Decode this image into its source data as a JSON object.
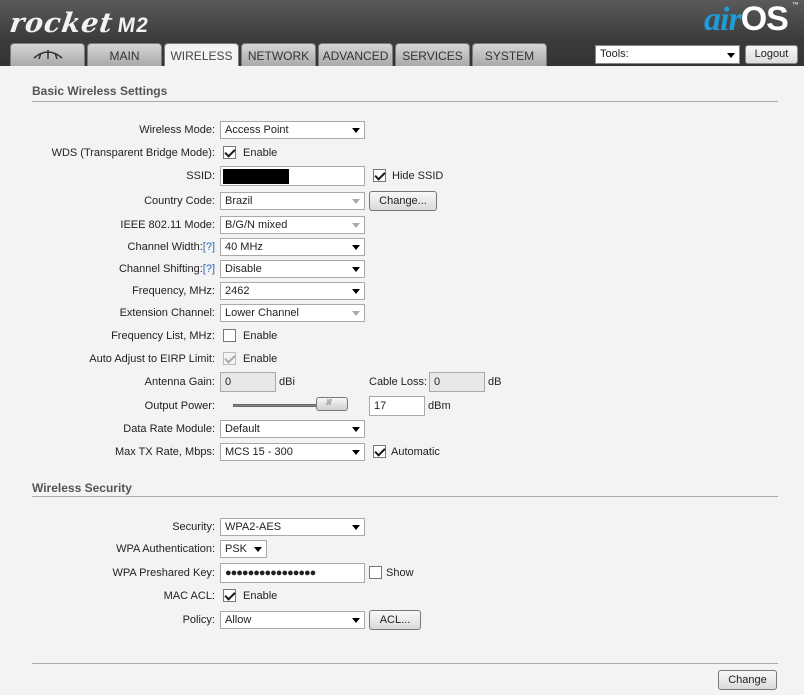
{
  "header": {
    "product": "rocket",
    "model": "M2",
    "brand_air": "air",
    "brand_os": "OS",
    "brand_tm": "™"
  },
  "tabs": [
    {
      "label": "",
      "icon": "ubiquiti-logo-icon"
    },
    {
      "label": "MAIN"
    },
    {
      "label": "WIRELESS"
    },
    {
      "label": "NETWORK"
    },
    {
      "label": "ADVANCED"
    },
    {
      "label": "SERVICES"
    },
    {
      "label": "SYSTEM"
    }
  ],
  "tools": {
    "value": "Tools:"
  },
  "logout_label": "Logout",
  "basic": {
    "title": "Basic Wireless Settings",
    "wireless_mode": {
      "label": "Wireless Mode:",
      "value": "Access Point"
    },
    "wds": {
      "label": "WDS (Transparent Bridge Mode):",
      "option": "Enable",
      "checked": true
    },
    "ssid": {
      "label": "SSID:",
      "value": "",
      "hide_label": "Hide SSID",
      "hide_checked": true
    },
    "country": {
      "label": "Country Code:",
      "value": "Brazil",
      "change_label": "Change..."
    },
    "ieee": {
      "label": "IEEE 802.11 Mode:",
      "value": "B/G/N mixed"
    },
    "channel_width": {
      "label": "Channel Width:",
      "help": "[?]",
      "value": "40 MHz"
    },
    "channel_shifting": {
      "label": "Channel Shifting:",
      "help": "[?]",
      "value": "Disable"
    },
    "frequency": {
      "label": "Frequency, MHz:",
      "value": "2462"
    },
    "extension": {
      "label": "Extension Channel:",
      "value": "Lower Channel"
    },
    "freq_list": {
      "label": "Frequency List, MHz:",
      "option": "Enable",
      "checked": false
    },
    "auto_adjust": {
      "label": "Auto Adjust to EIRP Limit:",
      "option": "Enable",
      "checked": true
    },
    "antenna_gain": {
      "label": "Antenna Gain:",
      "value": "0",
      "unit": "dBi"
    },
    "cable_loss": {
      "label": "Cable Loss:",
      "value": "0",
      "unit": "dB"
    },
    "output_power": {
      "label": "Output Power:",
      "value": "17",
      "unit": "dBm"
    },
    "data_rate": {
      "label": "Data Rate Module:",
      "value": "Default"
    },
    "max_tx": {
      "label": "Max TX Rate, Mbps:",
      "value": "MCS 15 - 300",
      "auto_label": "Automatic",
      "auto_checked": true
    }
  },
  "security": {
    "title": "Wireless Security",
    "security": {
      "label": "Security:",
      "value": "WPA2-AES"
    },
    "wpa_auth": {
      "label": "WPA Authentication:",
      "value": "PSK"
    },
    "psk": {
      "label": "WPA Preshared Key:",
      "value": "●●●●●●●●●●●●●●●●",
      "show_label": "Show",
      "show_checked": false
    },
    "mac_acl": {
      "label": "MAC ACL:",
      "option": "Enable",
      "checked": true
    },
    "policy": {
      "label": "Policy:",
      "value": "Allow",
      "acl_label": "ACL..."
    }
  },
  "change_label": "Change"
}
